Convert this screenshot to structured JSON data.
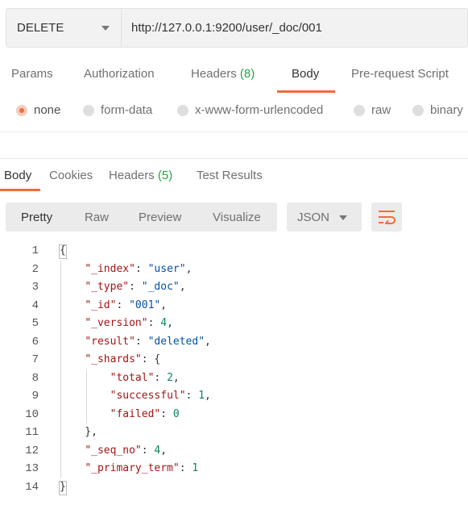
{
  "request": {
    "method": "DELETE",
    "url": "http://127.0.0.1:9200/user/_doc/001"
  },
  "request_tabs": [
    {
      "label": "Params",
      "count": ""
    },
    {
      "label": "Authorization",
      "count": ""
    },
    {
      "label": "Headers",
      "count": "(8)"
    },
    {
      "label": "Body",
      "count": "",
      "active": true
    },
    {
      "label": "Pre-request Script",
      "count": ""
    }
  ],
  "body_types": [
    {
      "label": "none",
      "selected": true
    },
    {
      "label": "form-data"
    },
    {
      "label": "x-www-form-urlencoded"
    },
    {
      "label": "raw"
    },
    {
      "label": "binary"
    }
  ],
  "response_tabs": [
    {
      "label": "Body",
      "count": "",
      "active": true
    },
    {
      "label": "Cookies",
      "count": ""
    },
    {
      "label": "Headers",
      "count": "(5)"
    },
    {
      "label": "Test Results",
      "count": ""
    }
  ],
  "view_modes": [
    "Pretty",
    "Raw",
    "Preview",
    "Visualize"
  ],
  "active_view": "Pretty",
  "format": "JSON",
  "wrap_icon": "wrap-lines-icon",
  "colors": {
    "accent": "#f26b3a",
    "count_green": "#27a443",
    "json_key": "#a31515",
    "json_string": "#0451a5",
    "json_number": "#098658"
  },
  "code_lines": [
    {
      "n": "1",
      "tokens": [
        [
          "p",
          "{"
        ]
      ]
    },
    {
      "n": "2",
      "tokens": [
        [
          "p",
          "    "
        ],
        [
          "k",
          "\"_index\""
        ],
        [
          "p",
          ": "
        ],
        [
          "s",
          "\"user\""
        ],
        [
          "p",
          ","
        ]
      ]
    },
    {
      "n": "3",
      "tokens": [
        [
          "p",
          "    "
        ],
        [
          "k",
          "\"_type\""
        ],
        [
          "p",
          ": "
        ],
        [
          "s",
          "\"_doc\""
        ],
        [
          "p",
          ","
        ]
      ]
    },
    {
      "n": "4",
      "tokens": [
        [
          "p",
          "    "
        ],
        [
          "k",
          "\"_id\""
        ],
        [
          "p",
          ": "
        ],
        [
          "s",
          "\"001\""
        ],
        [
          "p",
          ","
        ]
      ]
    },
    {
      "n": "5",
      "tokens": [
        [
          "p",
          "    "
        ],
        [
          "k",
          "\"_version\""
        ],
        [
          "p",
          ": "
        ],
        [
          "n",
          "4"
        ],
        [
          "p",
          ","
        ]
      ]
    },
    {
      "n": "6",
      "tokens": [
        [
          "p",
          "    "
        ],
        [
          "k",
          "\"result\""
        ],
        [
          "p",
          ": "
        ],
        [
          "s",
          "\"deleted\""
        ],
        [
          "p",
          ","
        ]
      ]
    },
    {
      "n": "7",
      "tokens": [
        [
          "p",
          "    "
        ],
        [
          "k",
          "\"_shards\""
        ],
        [
          "p",
          ": {"
        ]
      ]
    },
    {
      "n": "8",
      "tokens": [
        [
          "p",
          "        "
        ],
        [
          "k",
          "\"total\""
        ],
        [
          "p",
          ": "
        ],
        [
          "n",
          "2"
        ],
        [
          "p",
          ","
        ]
      ]
    },
    {
      "n": "9",
      "tokens": [
        [
          "p",
          "        "
        ],
        [
          "k",
          "\"successful\""
        ],
        [
          "p",
          ": "
        ],
        [
          "n",
          "1"
        ],
        [
          "p",
          ","
        ]
      ]
    },
    {
      "n": "10",
      "tokens": [
        [
          "p",
          "        "
        ],
        [
          "k",
          "\"failed\""
        ],
        [
          "p",
          ": "
        ],
        [
          "n",
          "0"
        ]
      ]
    },
    {
      "n": "11",
      "tokens": [
        [
          "p",
          "    },"
        ]
      ]
    },
    {
      "n": "12",
      "tokens": [
        [
          "p",
          "    "
        ],
        [
          "k",
          "\"_seq_no\""
        ],
        [
          "p",
          ": "
        ],
        [
          "n",
          "4"
        ],
        [
          "p",
          ","
        ]
      ]
    },
    {
      "n": "13",
      "tokens": [
        [
          "p",
          "    "
        ],
        [
          "k",
          "\"_primary_term\""
        ],
        [
          "p",
          ": "
        ],
        [
          "n",
          "1"
        ]
      ]
    },
    {
      "n": "14",
      "tokens": [
        [
          "p",
          "}"
        ]
      ]
    }
  ]
}
